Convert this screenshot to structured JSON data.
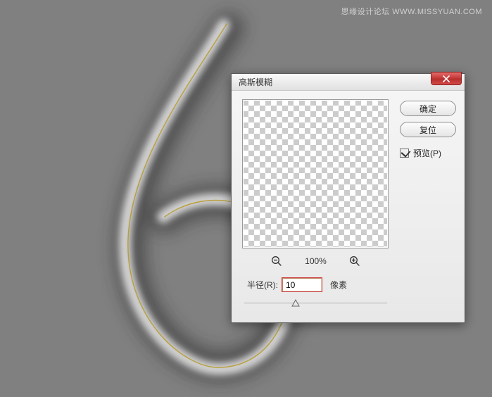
{
  "watermark": "思缘设计论坛   WWW.MISSYUAN.COM",
  "dialog": {
    "title": "高斯模糊",
    "ok_label": "确定",
    "reset_label": "复位",
    "preview_label": "预览(P)",
    "preview_checked": true,
    "zoom_percent": "100%",
    "radius_label": "半径(R):",
    "radius_value": "10",
    "unit_label": "像素"
  }
}
